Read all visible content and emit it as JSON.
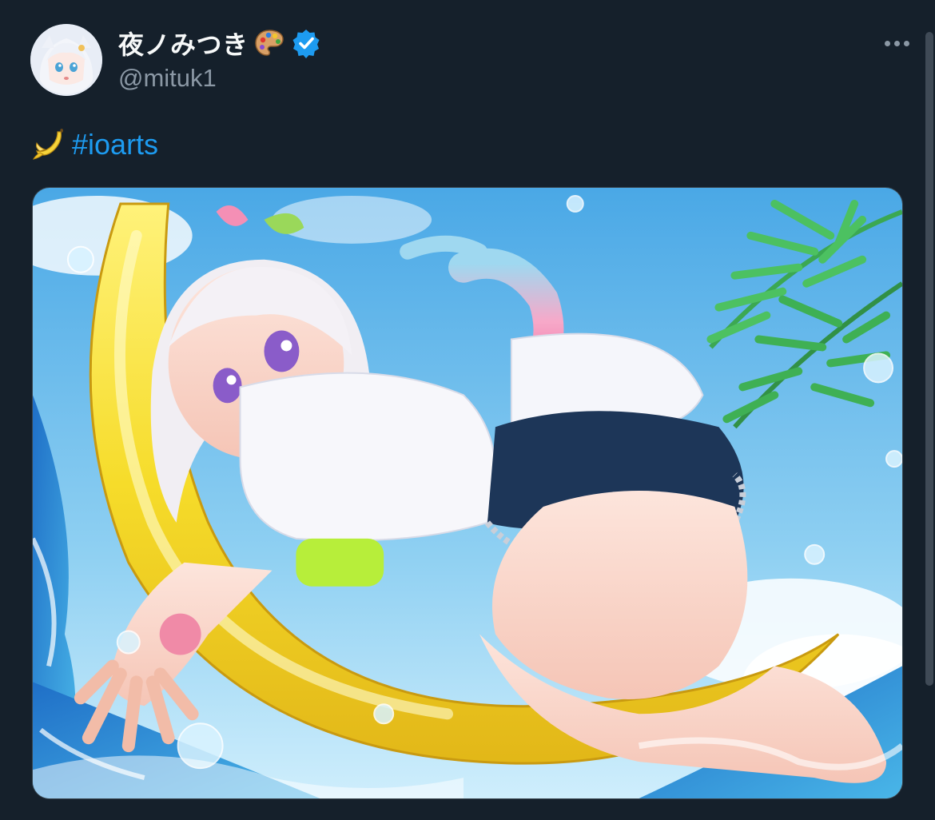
{
  "author": {
    "display_name": "夜ノみつき",
    "handle": "@mituk1",
    "name_icons": [
      "palette-icon",
      "verified-icon"
    ],
    "verified_color": "#1d9bf0"
  },
  "menu": {
    "more_icon": "more-horizontal-icon"
  },
  "tweet": {
    "emoji": "banana-emoji",
    "hashtag": "#ioarts"
  },
  "media": {
    "kind": "illustration",
    "icon": "image-icon"
  },
  "colors": {
    "background": "#15202b",
    "text": "#f7f9f9",
    "secondary_text": "#8b98a5",
    "link": "#1d9bf0"
  }
}
